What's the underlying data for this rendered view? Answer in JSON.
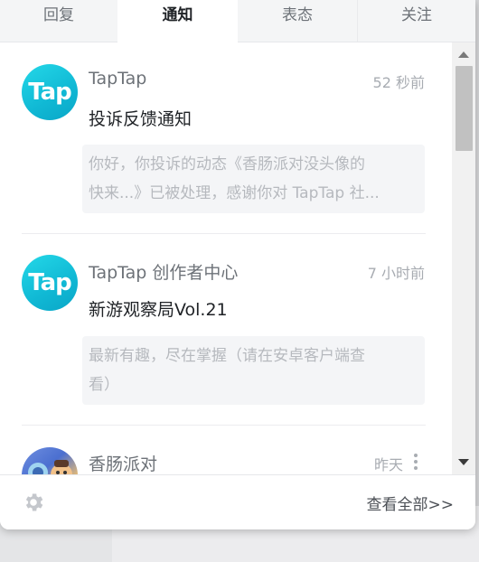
{
  "tabs": [
    {
      "label": "回复",
      "active": false
    },
    {
      "label": "通知",
      "active": true
    },
    {
      "label": "表态",
      "active": false
    },
    {
      "label": "关注",
      "active": false
    }
  ],
  "notifications": [
    {
      "avatar_text": "Tap",
      "name": "TapTap",
      "time": "52 秒前",
      "title": "投诉反馈通知",
      "preview_line1": "你好，你投诉的动态《香肠派对没头像的",
      "preview_line2": "快来...》已被处理，感谢你对 TapTap 社..."
    },
    {
      "avatar_text": "Tap",
      "name": "TapTap 创作者中心",
      "time": "7 小时前",
      "title": "新游观察局Vol.21",
      "preview_line1": "最新有趣，尽在掌握（请在安卓客户端查",
      "preview_line2": "看）"
    },
    {
      "name": "香肠派对",
      "time": "昨天"
    }
  ],
  "footer": {
    "view_all": "查看全部>>"
  },
  "colors": {
    "accent": "#14c0d8",
    "text_primary": "#1f2226",
    "text_secondary": "#6d7278",
    "text_muted": "#b6b9be"
  },
  "icons": {
    "settings": "gear-icon",
    "more": "more-vertical-icon"
  }
}
